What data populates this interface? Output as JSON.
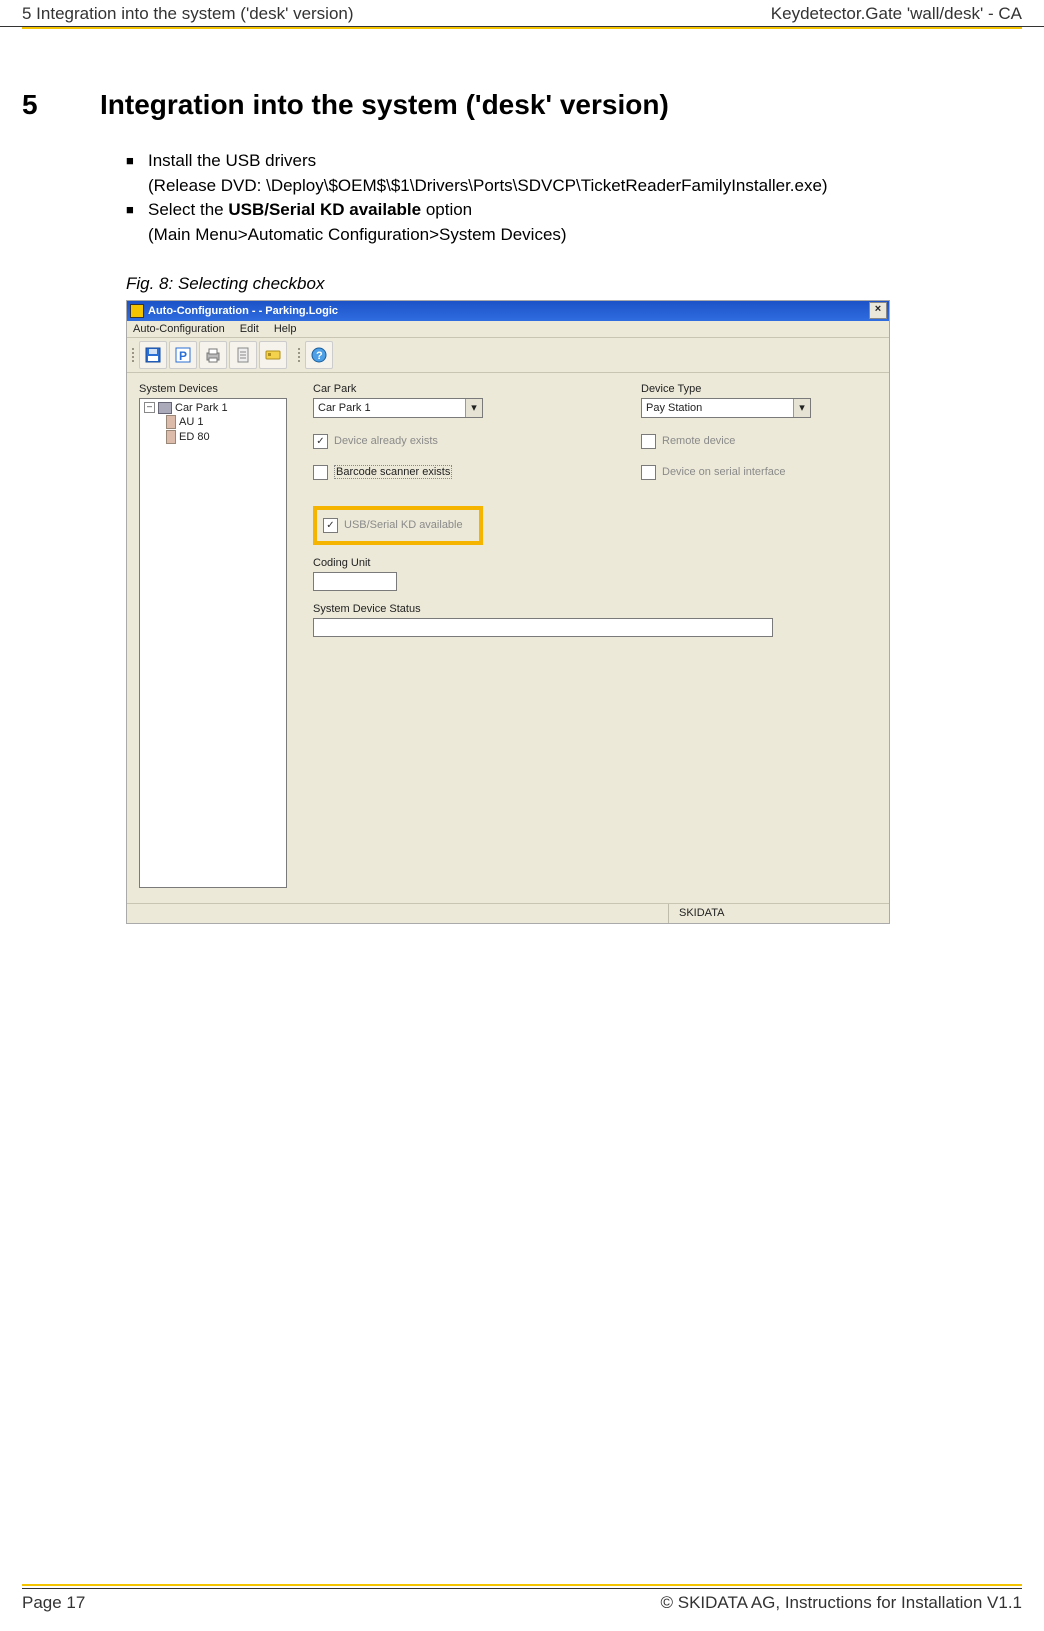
{
  "header": {
    "left": "5 Integration into the system ('desk' version)",
    "right": "Keydetector.Gate 'wall/desk' - CA"
  },
  "section": {
    "number": "5",
    "title": "Integration into the system ('desk' version)"
  },
  "bullets": {
    "b1_line1": "Install the USB drivers",
    "b1_line2": "(Release DVD: \\Deploy\\$OEM$\\$1\\Drivers\\Ports\\SDVCP\\TicketReaderFamilyInstaller.exe)",
    "b2_pre": "Select the ",
    "b2_bold": "USB/Serial KD available",
    "b2_post": " option",
    "b2_line2": "(Main Menu>Automatic Configuration>System Devices)"
  },
  "figure_caption": "Fig. 8: Selecting checkbox",
  "app": {
    "title": "Auto-Configuration -  - Parking.Logic",
    "close": "×",
    "menu": {
      "autoconfig": "Auto-Configuration",
      "edit": "Edit",
      "help": "Help"
    },
    "labels": {
      "system_devices": "System Devices",
      "car_park": "Car Park",
      "device_type": "Device Type",
      "coding_unit": "Coding Unit",
      "system_device_status": "System Device Status"
    },
    "tree": {
      "root": "Car Park 1",
      "child1": "AU 1",
      "child2": "ED 80",
      "toggle": "–"
    },
    "dropdowns": {
      "car_park_value": "Car Park 1",
      "device_type_value": "Pay Station"
    },
    "checks": {
      "already_exists": "Device already exists",
      "barcode": "Barcode scanner exists",
      "usb_kd": "USB/Serial KD available",
      "remote": "Remote device",
      "serial": "Device on serial interface",
      "check_mark": "✓"
    },
    "statusbar": "SKIDATA"
  },
  "footer": {
    "left": "Page 17",
    "right": "© SKIDATA AG, Instructions for Installation V1.1"
  },
  "icons": {
    "chevron": "▾"
  }
}
